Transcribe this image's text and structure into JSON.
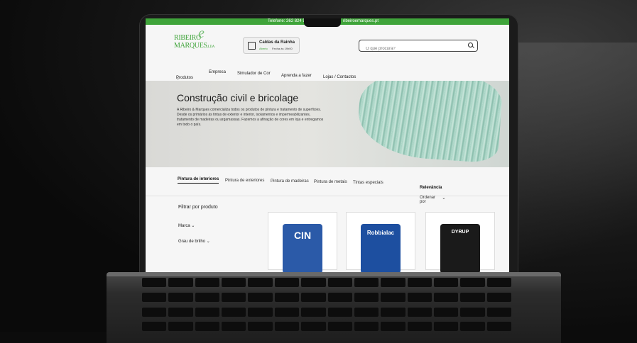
{
  "topbar": {
    "phone": "Telefone: 262 824 5",
    "email": "ribeiroemarques.pt"
  },
  "logo": {
    "line1": "RIBEIRO",
    "amp": "e",
    "line2": "MARQUES",
    "suffix": ",LDA"
  },
  "store": {
    "name": "Caldas da Rainha",
    "status": "Aberto",
    "hours": "Fecha às 19h00"
  },
  "search": {
    "placeholder": "O que procura?"
  },
  "nav": {
    "items": [
      "Produtos",
      "Empresa",
      "Simulador de Cor",
      "Aprenda a fazer",
      "Lojas / Contactos"
    ]
  },
  "hero": {
    "title": "Construção civil e bricolage",
    "text": "A Ribeiro & Marques comercializa todos os produtos de pintura e tratamento de superfícies. Desde os primários às tintas de exterior e interior, isolamentos e impermeabilizantes, tratamento de madeiras ou argamassas. Fazemos a afinação de cores em loja e entregamos em todo o país."
  },
  "tabs": [
    "Pintura de interiores",
    "Pintura de exteriores",
    "Pintura de madeiras",
    "Pintura de metais",
    "Tintas especiais"
  ],
  "sort": {
    "label": "Ordenar por",
    "value": "Relevância"
  },
  "filters": {
    "title": "Filtrar por produto",
    "items": [
      "Marca",
      "Grau de brilho"
    ]
  },
  "products": [
    {
      "brand": "CIN",
      "color": "#2b5aa8"
    },
    {
      "brand": "Robbialac",
      "color": "#1d4fa0"
    },
    {
      "brand": "DYRUP",
      "color": "#1a1a1a"
    }
  ]
}
